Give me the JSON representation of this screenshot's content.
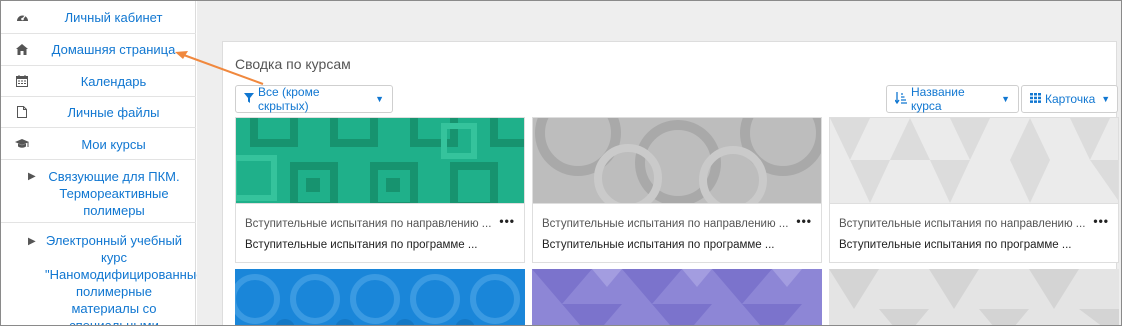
{
  "sidebar": {
    "items": [
      {
        "label": "Личный кабинет",
        "icon": "dashboard-icon"
      },
      {
        "label": "Домашняя страница",
        "icon": "home-icon"
      },
      {
        "label": "Календарь",
        "icon": "calendar-icon"
      },
      {
        "label": "Личные файлы",
        "icon": "file-icon"
      },
      {
        "label": "Мои курсы",
        "icon": "graduation-cap-icon"
      }
    ],
    "courses": [
      {
        "label": "Связующие для ПКМ. Термореактивные полимеры"
      },
      {
        "label": "Электронный учебный курс \"Наномодифицированные полимерные материалы со специальными"
      }
    ]
  },
  "overview": {
    "title": "Сводка по курсам",
    "filter_label": "Все (кроме скрытых)",
    "sort_label": "Название курса",
    "view_label": "Карточка"
  },
  "courses": [
    {
      "category": "Вступительные испытания по направлению ...",
      "name": "Вступительные испытания по программе ...",
      "color": "#1fb08a"
    },
    {
      "category": "Вступительные испытания по направлению ...",
      "name": "Вступительные испытания по программе ...",
      "color": "#b8b8b8"
    },
    {
      "category": "Вступительные испытания по направлению ...",
      "name": "Вступительные испытания по программе ...",
      "color": "#e7e7e7"
    }
  ],
  "colors": {
    "link": "#1177d1",
    "arrow": "#f0883e"
  }
}
